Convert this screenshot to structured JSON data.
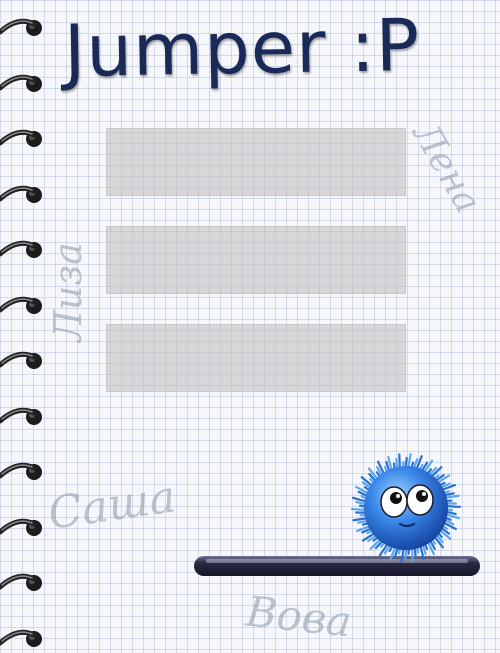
{
  "game": {
    "title": "Jumper :P",
    "menu_slots": [
      "",
      "",
      ""
    ],
    "scribbles": {
      "lena": "Лена",
      "liza": "Лиза",
      "sasha": "Саша",
      "vova": "Вова"
    }
  },
  "colors": {
    "title_ink": "#1a2a58",
    "pencil": "#8c96aa",
    "monster_blue": "#2f6fd8",
    "platform_dark": "#2a2a44",
    "slot_gray": "#bebebe"
  },
  "icons": {
    "binding": "spiral-ring-icon",
    "character": "fuzzy-monster-icon",
    "platform": "platform-bar-icon"
  }
}
